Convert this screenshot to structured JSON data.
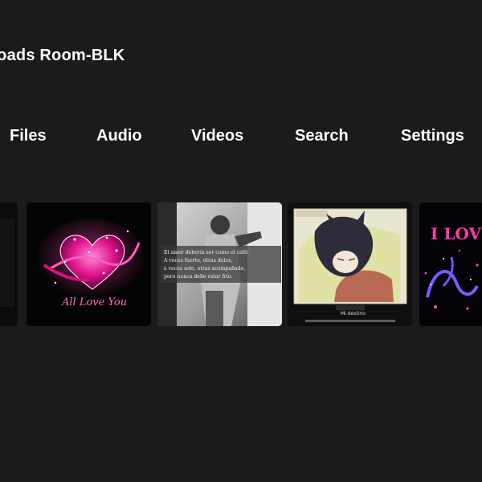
{
  "app": {
    "title": "ploads Room-BLK"
  },
  "nav": {
    "items": [
      {
        "label": "Files"
      },
      {
        "label": "Audio"
      },
      {
        "label": "Videos"
      },
      {
        "label": "Search"
      },
      {
        "label": "Settings"
      }
    ]
  },
  "thumbnails": [
    {
      "icon": "image-thumbnail"
    },
    {
      "icon": "pink-heart-image",
      "caption": "All Love You"
    },
    {
      "icon": "photo-with-text",
      "text": [
        "El amor debería ser como el café:",
        "A veces fuerte, otras dulce,",
        "a veces solo, otras acompañado,",
        "pero nunca debe estar frío."
      ]
    },
    {
      "icon": "anime-sketch-image",
      "caption": "Mi destino"
    },
    {
      "icon": "glitter-love-image",
      "text": "I LOVE"
    }
  ],
  "colors": {
    "background": "#1b1b1c",
    "text": "#ffffff",
    "accent_pink": "#ff3fae"
  }
}
